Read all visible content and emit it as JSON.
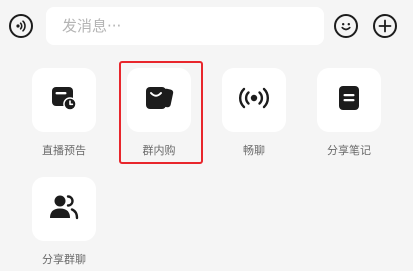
{
  "input_bar": {
    "placeholder": "发消息···",
    "voice_icon": "voice-wave-icon",
    "emoji_icon": "smiley-icon",
    "plus_icon": "plus-icon"
  },
  "panel": {
    "items": [
      {
        "label": "直播预告",
        "icon": "live-calendar-clock-icon"
      },
      {
        "label": "群内购",
        "icon": "shopping-bag-icon",
        "highlighted": true
      },
      {
        "label": "畅聊",
        "icon": "broadcast-signal-icon"
      },
      {
        "label": "分享笔记",
        "icon": "note-icon"
      },
      {
        "label": "分享群聊",
        "icon": "group-users-icon"
      }
    ]
  },
  "colors": {
    "background": "#f5f5f5",
    "tile": "#ffffff",
    "icon": "#1c1c1c",
    "highlight": "#e8262c",
    "label": "#6a6a6a"
  }
}
